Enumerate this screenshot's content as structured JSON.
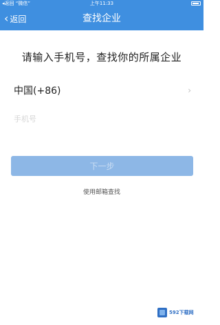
{
  "status_bar": {
    "carrier": "◂返回 “微信”",
    "time": "上午11:33"
  },
  "nav": {
    "back_label": "返回",
    "title": "查找企业"
  },
  "main": {
    "heading": "请输入手机号，查找你的所属企业",
    "country_code": "中国(+86)",
    "country_arrow": "›",
    "phone_placeholder": "手机号",
    "phone_value": "",
    "next_label": "下一步",
    "email_link": "使用邮箱查找"
  },
  "watermark": {
    "text": "592下载网"
  },
  "colors": {
    "nav_bg": "#3f8fe0",
    "button_disabled": "#8db7e6"
  },
  "icons": {
    "back": "chevron-left-icon",
    "country_arrow": "chevron-right-icon",
    "battery": "battery-icon"
  }
}
